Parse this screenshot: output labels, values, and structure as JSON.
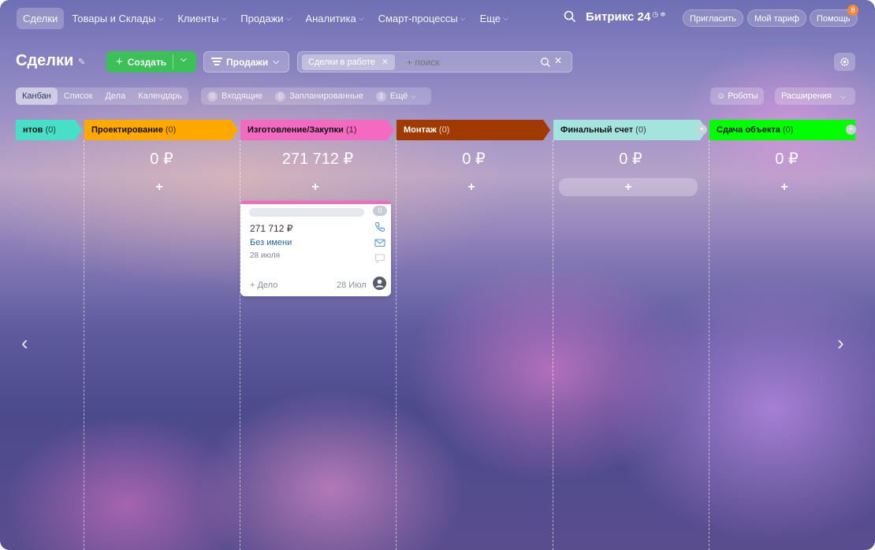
{
  "nav": {
    "items": [
      {
        "label": "Сделки",
        "caret": false
      },
      {
        "label": "Товары и Склады",
        "caret": true
      },
      {
        "label": "Клиенты",
        "caret": true
      },
      {
        "label": "Продажи",
        "caret": true
      },
      {
        "label": "Аналитика",
        "caret": true
      },
      {
        "label": "Смарт-процессы",
        "caret": true
      },
      {
        "label": "Еще",
        "caret": true
      }
    ],
    "brand": "Битрикс 24",
    "invite": "Пригласить",
    "tariff": "Мой тариф",
    "help": "Помощь",
    "help_badge": "8"
  },
  "toolbar": {
    "title": "Сделки",
    "create": "Создать",
    "pipeline": "Продажи",
    "filter_chip": "Сделки в работе",
    "search_placeholder": "+ поиск"
  },
  "views": [
    "Канбан",
    "Список",
    "Дела",
    "Календарь"
  ],
  "counters": [
    {
      "num": "0",
      "label": "Входящие"
    },
    {
      "num": "0",
      "label": "Запланированные"
    },
    {
      "num": "3",
      "label": "Ещё"
    }
  ],
  "right": {
    "robots": "Роботы",
    "extensions": "Расширения"
  },
  "stages": [
    {
      "name": "нтов",
      "count": "(0)",
      "color": "#47e0c6",
      "sum": ""
    },
    {
      "name": "Проектирование",
      "count": "(0)",
      "color": "#ffa900",
      "sum": "0 ₽"
    },
    {
      "name": "Изготовление/Закупки",
      "count": "(1)",
      "color": "#f469c1",
      "sum": "271 712 ₽"
    },
    {
      "name": "Монтаж",
      "count": "(0)",
      "color": "#a13a00",
      "sum": "0 ₽"
    },
    {
      "name": "Финальный счет",
      "count": "(0)",
      "color": "#a5e4dd",
      "sum": "0 ₽"
    },
    {
      "name": "Сдача объекта",
      "count": "(0)",
      "color": "#00ff00",
      "sum": "0 ₽"
    }
  ],
  "card": {
    "amount": "271 712 ₽",
    "client": "Без имени",
    "date": "28 июля",
    "badge": "0",
    "action": "+ Дело",
    "due": "28 Июл"
  },
  "colors": {
    "create": "#3bc157",
    "link": "#2067b0"
  }
}
